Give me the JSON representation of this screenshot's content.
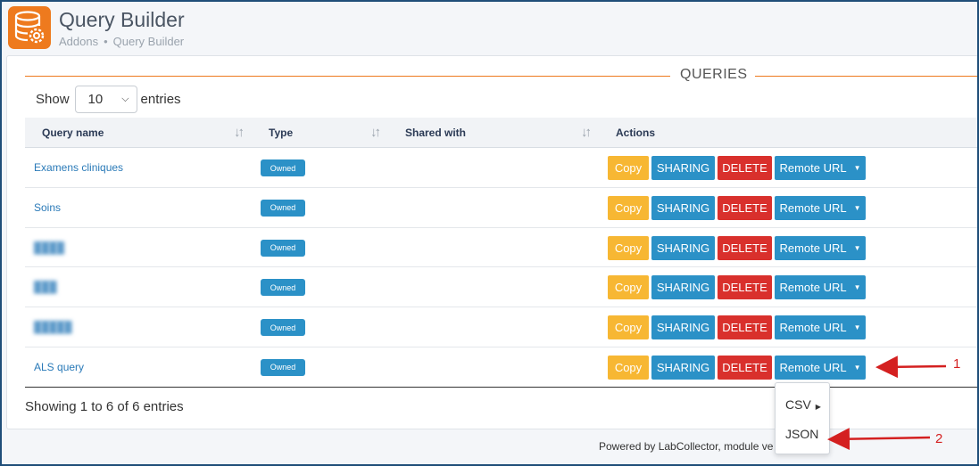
{
  "header": {
    "title": "Query Builder",
    "breadcrumb": [
      "Addons",
      "Query Builder"
    ],
    "icon": "database-gear-icon",
    "accent": "#ee7a1e"
  },
  "section": {
    "title": "QUERIES"
  },
  "length": {
    "prefix": "Show",
    "value": "10",
    "suffix": "entries"
  },
  "table": {
    "columns": [
      "Query name",
      "Type",
      "Shared with",
      "Actions"
    ],
    "rows": [
      {
        "name": "Examens cliniques",
        "type": "Owned",
        "shared": ""
      },
      {
        "name": "Soins",
        "type": "Owned",
        "shared": ""
      },
      {
        "name": "",
        "type": "Owned",
        "shared": ""
      },
      {
        "name": "",
        "type": "Owned",
        "shared": ""
      },
      {
        "name": "",
        "type": "Owned",
        "shared": ""
      },
      {
        "name": "ALS query",
        "type": "Owned",
        "shared": ""
      }
    ],
    "actions": {
      "copy": "Copy",
      "sharing": "SHARING",
      "delete": "DELETE",
      "remote": "Remote URL"
    }
  },
  "info": "Showing 1 to 6 of 6 entries",
  "dropdown": {
    "items": [
      "CSV",
      "JSON"
    ]
  },
  "footer": "Powered by LabCollector, module ve",
  "annotations": [
    "1",
    "2"
  ],
  "colors": {
    "owned": "#2b91c7",
    "copy": "#f7b733",
    "delete": "#d9302c",
    "link": "#2a7ab8",
    "annotation": "#d42020"
  }
}
